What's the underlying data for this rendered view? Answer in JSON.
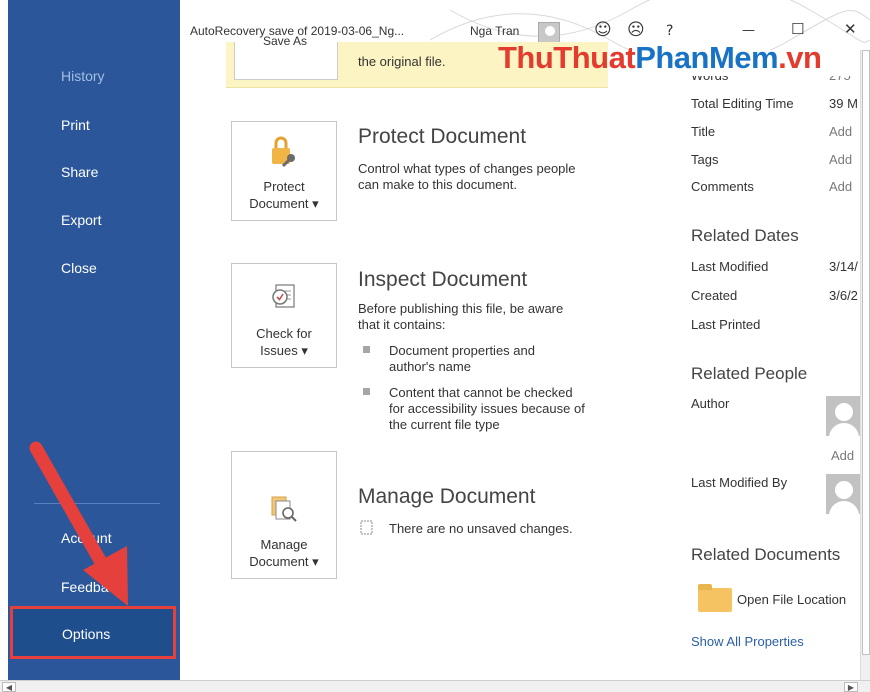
{
  "nav": {
    "history": "History",
    "print": "Print",
    "share": "Share",
    "export": "Export",
    "close": "Close",
    "account": "Account",
    "feedback": "Feedback",
    "options": "Options"
  },
  "titlebar": {
    "title": "AutoRecovery save of 2019-03-06_Ng...",
    "user": "Nga Tran",
    "smile_icon": "☺",
    "frown_icon": "☹",
    "help": "?",
    "minimize": "—",
    "maximize": "☐",
    "close": "✕"
  },
  "watermark": {
    "part1": "ThuThuat",
    "part2": "PhanMem",
    "part3": ".vn"
  },
  "banner": {
    "button_label": "Save As",
    "text": "the original file."
  },
  "protect": {
    "button_line1": "Protect",
    "button_line2": "Document ▾",
    "title": "Protect Document",
    "desc_line1": "Control what types of changes people",
    "desc_line2": "can make to this document."
  },
  "inspect": {
    "button_line1": "Check for",
    "button_line2": "Issues ▾",
    "title": "Inspect Document",
    "desc_line1": "Before publishing this file, be aware",
    "desc_line2": "that it contains:",
    "bullets": [
      {
        "line1": "Document properties and",
        "line2": "author's name"
      },
      {
        "line1": "Content that cannot be checked",
        "line2": "for accessibility issues because of",
        "line3": "the current file type"
      }
    ]
  },
  "manage": {
    "button_line1": "Manage",
    "button_line2": "Document ▾",
    "title": "Manage Document",
    "status": "There are no unsaved changes."
  },
  "properties": {
    "words_label": "Words",
    "words_value": "275",
    "editing_time_label": "Total Editing Time",
    "editing_time_value": "39 M",
    "title_label": "Title",
    "title_value": "Add",
    "tags_label": "Tags",
    "tags_value": "Add",
    "comments_label": "Comments",
    "comments_value": "Add",
    "related_dates": "Related Dates",
    "last_modified_label": "Last Modified",
    "last_modified_value": "3/14/",
    "created_label": "Created",
    "created_value": "3/6/2",
    "last_printed_label": "Last Printed",
    "related_people": "Related People",
    "author_label": "Author",
    "add_author": "Add",
    "last_modified_by_label": "Last Modified By",
    "related_documents": "Related Documents",
    "open_file_location": "Open File Location",
    "show_all": "Show All Properties"
  },
  "colors": {
    "nav_bg": "#2b579a",
    "options_bg": "#1e4e8c",
    "highlight": "#e5403b",
    "banner": "#fcf4c3"
  }
}
